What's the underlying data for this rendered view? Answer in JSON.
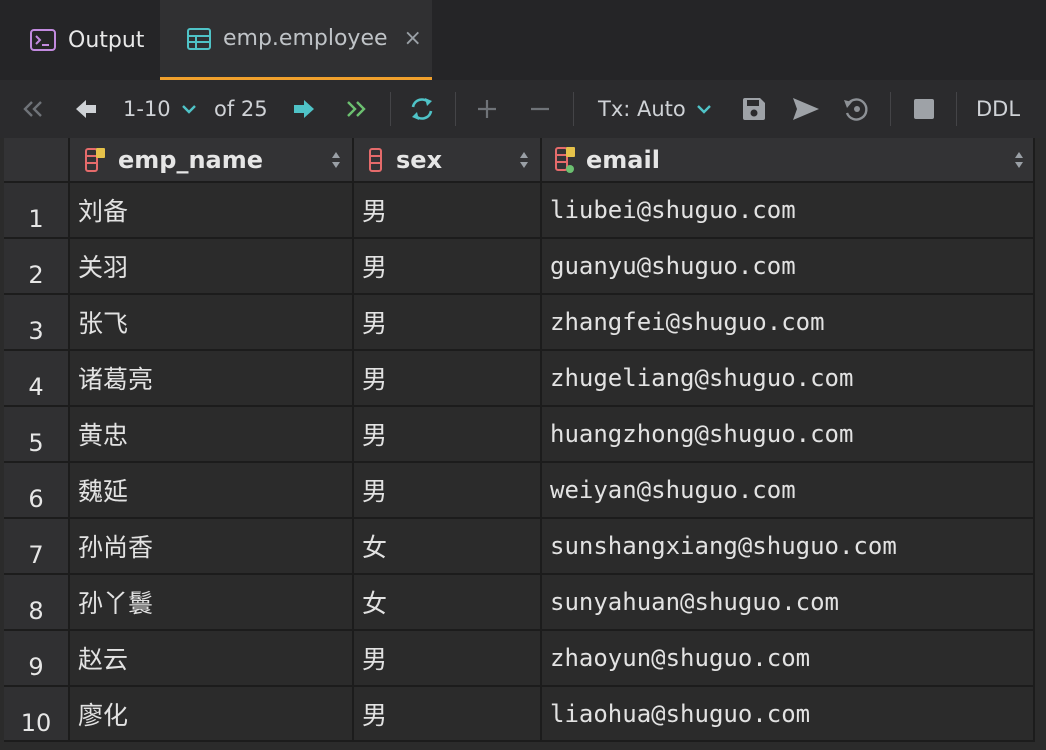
{
  "tabs": {
    "output_label": "Output",
    "table_label": "emp.employee",
    "close_glyph": "×"
  },
  "toolbar": {
    "range": "1-10",
    "of_label": "of 25",
    "tx_label": "Tx: Auto",
    "ddl_label": "DDL"
  },
  "columns": [
    {
      "name": "emp_name"
    },
    {
      "name": "sex"
    },
    {
      "name": "email"
    }
  ],
  "rows": [
    {
      "num": "1",
      "emp_name": "刘备",
      "sex": "男",
      "email": "liubei@shuguo.com"
    },
    {
      "num": "2",
      "emp_name": "关羽",
      "sex": "男",
      "email": "guanyu@shuguo.com"
    },
    {
      "num": "3",
      "emp_name": "张飞",
      "sex": "男",
      "email": "zhangfei@shuguo.com"
    },
    {
      "num": "4",
      "emp_name": "诸葛亮",
      "sex": "男",
      "email": "zhugeliang@shuguo.com"
    },
    {
      "num": "5",
      "emp_name": "黄忠",
      "sex": "男",
      "email": "huangzhong@shuguo.com"
    },
    {
      "num": "6",
      "emp_name": "魏延",
      "sex": "男",
      "email": "weiyan@shuguo.com"
    },
    {
      "num": "7",
      "emp_name": "孙尚香",
      "sex": "女",
      "email": "sunshangxiang@shuguo.com"
    },
    {
      "num": "8",
      "emp_name": "孙丫鬟",
      "sex": "女",
      "email": "sunyahuan@shuguo.com"
    },
    {
      "num": "9",
      "emp_name": "赵云",
      "sex": "男",
      "email": "zhaoyun@shuguo.com"
    },
    {
      "num": "10",
      "emp_name": "廖化",
      "sex": "男",
      "email": "liaohua@shuguo.com"
    }
  ],
  "colors": {
    "accent_tab_underline": "#f0a02c",
    "teal_icon": "#4fc3c7",
    "green_icon": "#6cc070",
    "column_icon": "#e56b6b"
  }
}
